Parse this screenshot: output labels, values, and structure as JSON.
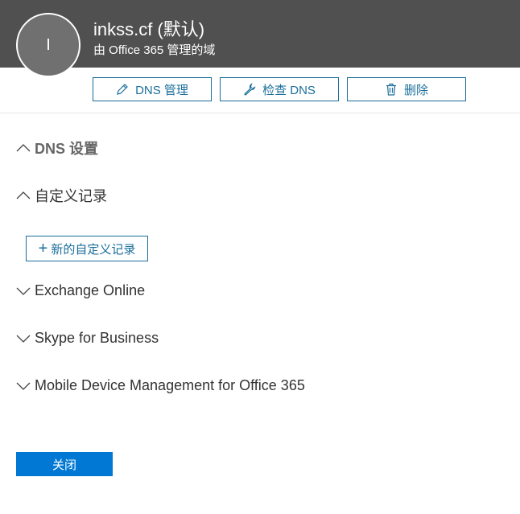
{
  "header": {
    "avatar_letter": "I",
    "title": "inkss.cf (默认)",
    "subtitle": "由 Office 365 管理的域"
  },
  "toolbar": {
    "dns_manage_label": "DNS 管理",
    "check_dns_label": "检查 DNS",
    "delete_label": "删除"
  },
  "sections": {
    "dns_settings": "DNS 设置",
    "custom_records": "自定义记录",
    "new_custom_record": "新的自定义记录",
    "exchange_online": "Exchange Online",
    "skype": "Skype for Business",
    "mdm": "Mobile Device Management for Office 365"
  },
  "footer": {
    "close_label": "关闭"
  },
  "colors": {
    "header_bg": "#505050",
    "accent": "#1a6e9b",
    "primary_button": "#0078d4"
  }
}
